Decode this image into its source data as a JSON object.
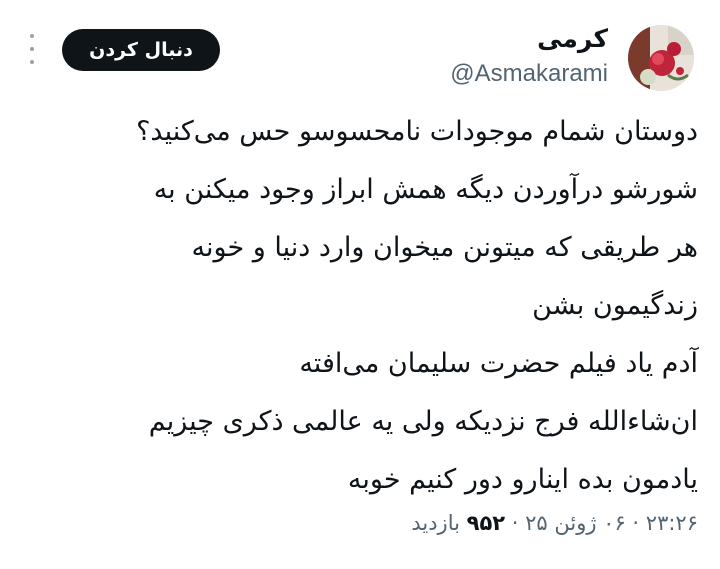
{
  "header": {
    "menu_icon": "more-vertical-icon",
    "follow_label": "دنبال کردن",
    "display_name": "کرمی",
    "handle": "@Asmakarami",
    "avatar_icon": "profile-photo-roses"
  },
  "tweet": {
    "lines": [
      "دوستان شمام موجودات نامحسوسو حس می‌کنید؟",
      "شورشو درآوردن دیگه همش ابراز وجود میکنن به",
      "هر طریقی که میتونن میخوان وارد دنیا و خونه",
      "زندگیمون بشن",
      "آدم یاد فیلم حضرت سلیمان می‌افته",
      "ان‌شاءالله فرج نزدیکه ولی یه عالمی ذکری چیزیم",
      "یادمون بده اینارو دور کنیم خوبه"
    ]
  },
  "meta": {
    "time": "۲۳:۲۶",
    "date": "۰۶ ژوئن ۲۵",
    "separator": "·",
    "views_count": "۹۵۲",
    "views_label": "بازدید"
  },
  "colors": {
    "text": "#0f1419",
    "secondary": "#536471",
    "button_bg": "#0f1419",
    "button_text": "#ffffff"
  }
}
